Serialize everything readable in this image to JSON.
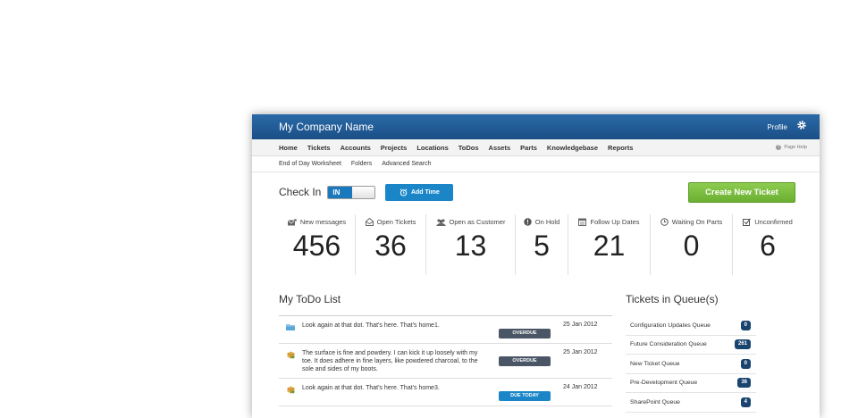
{
  "app": {
    "company_name": "My Company Name",
    "profile_label": "Profile",
    "gear_icon": "gear-icon"
  },
  "main_nav": {
    "items": [
      "Home",
      "Tickets",
      "Accounts",
      "Projects",
      "Locations",
      "ToDos",
      "Assets",
      "Parts",
      "Knowledgebase",
      "Reports"
    ],
    "page_help": "Page Help"
  },
  "sub_nav": {
    "items": [
      "End of Day Worksheet",
      "Folders",
      "Advanced Search"
    ]
  },
  "check_in": {
    "label": "Check In",
    "toggle_state": "IN",
    "add_time_label": "Add Time",
    "create_ticket_label": "Create New Ticket"
  },
  "stats": [
    {
      "label": "New messages",
      "value": "456",
      "icon": "messages-icon"
    },
    {
      "label": "Open Tickets",
      "value": "36",
      "icon": "open-ticket-icon"
    },
    {
      "label": "Open as Customer",
      "value": "13",
      "icon": "customer-icon"
    },
    {
      "label": "On Hold",
      "value": "5",
      "icon": "on-hold-icon"
    },
    {
      "label": "Follow Up Dates",
      "value": "21",
      "icon": "calendar-icon"
    },
    {
      "label": "Waiting On Parts",
      "value": "0",
      "icon": "clock-icon"
    },
    {
      "label": "Unconfirmed",
      "value": "6",
      "icon": "checkbox-icon"
    }
  ],
  "todo": {
    "title": "My ToDo List",
    "items": [
      {
        "text": "Look again at that dot. That's here. That's home1.",
        "status": "OVERDUE",
        "date": "25 Jan 2012",
        "icon": "folder-icon"
      },
      {
        "text": "The surface is fine and powdery. I can kick it up loosely with my toe. It does adhere in fine layers, like powdered charcoal, to the sole and sides of my boots.",
        "status": "OVERDUE",
        "date": "25 Jan 2012",
        "icon": "box-icon"
      },
      {
        "text": "Look again at that dot. That's here. That's home3.",
        "status": "DUE TODAY",
        "date": "24 Jan 2012",
        "icon": "box-icon"
      }
    ]
  },
  "queues": {
    "title": "Tickets in Queue(s)",
    "items": [
      {
        "name": "Configuration Updates Queue",
        "count": "0"
      },
      {
        "name": "Future Consideration Queue",
        "count": "261"
      },
      {
        "name": "New Ticket Queue",
        "count": "0"
      },
      {
        "name": "Pre-Development Queue",
        "count": "36"
      },
      {
        "name": "SharePoint Queue",
        "count": "4"
      }
    ]
  },
  "colors": {
    "header_blue": "#1b4f86",
    "accent_blue": "#1a86c8",
    "create_green": "#7bbf42",
    "overdue": "#4a5566",
    "queue_badge": "#1a4470"
  }
}
